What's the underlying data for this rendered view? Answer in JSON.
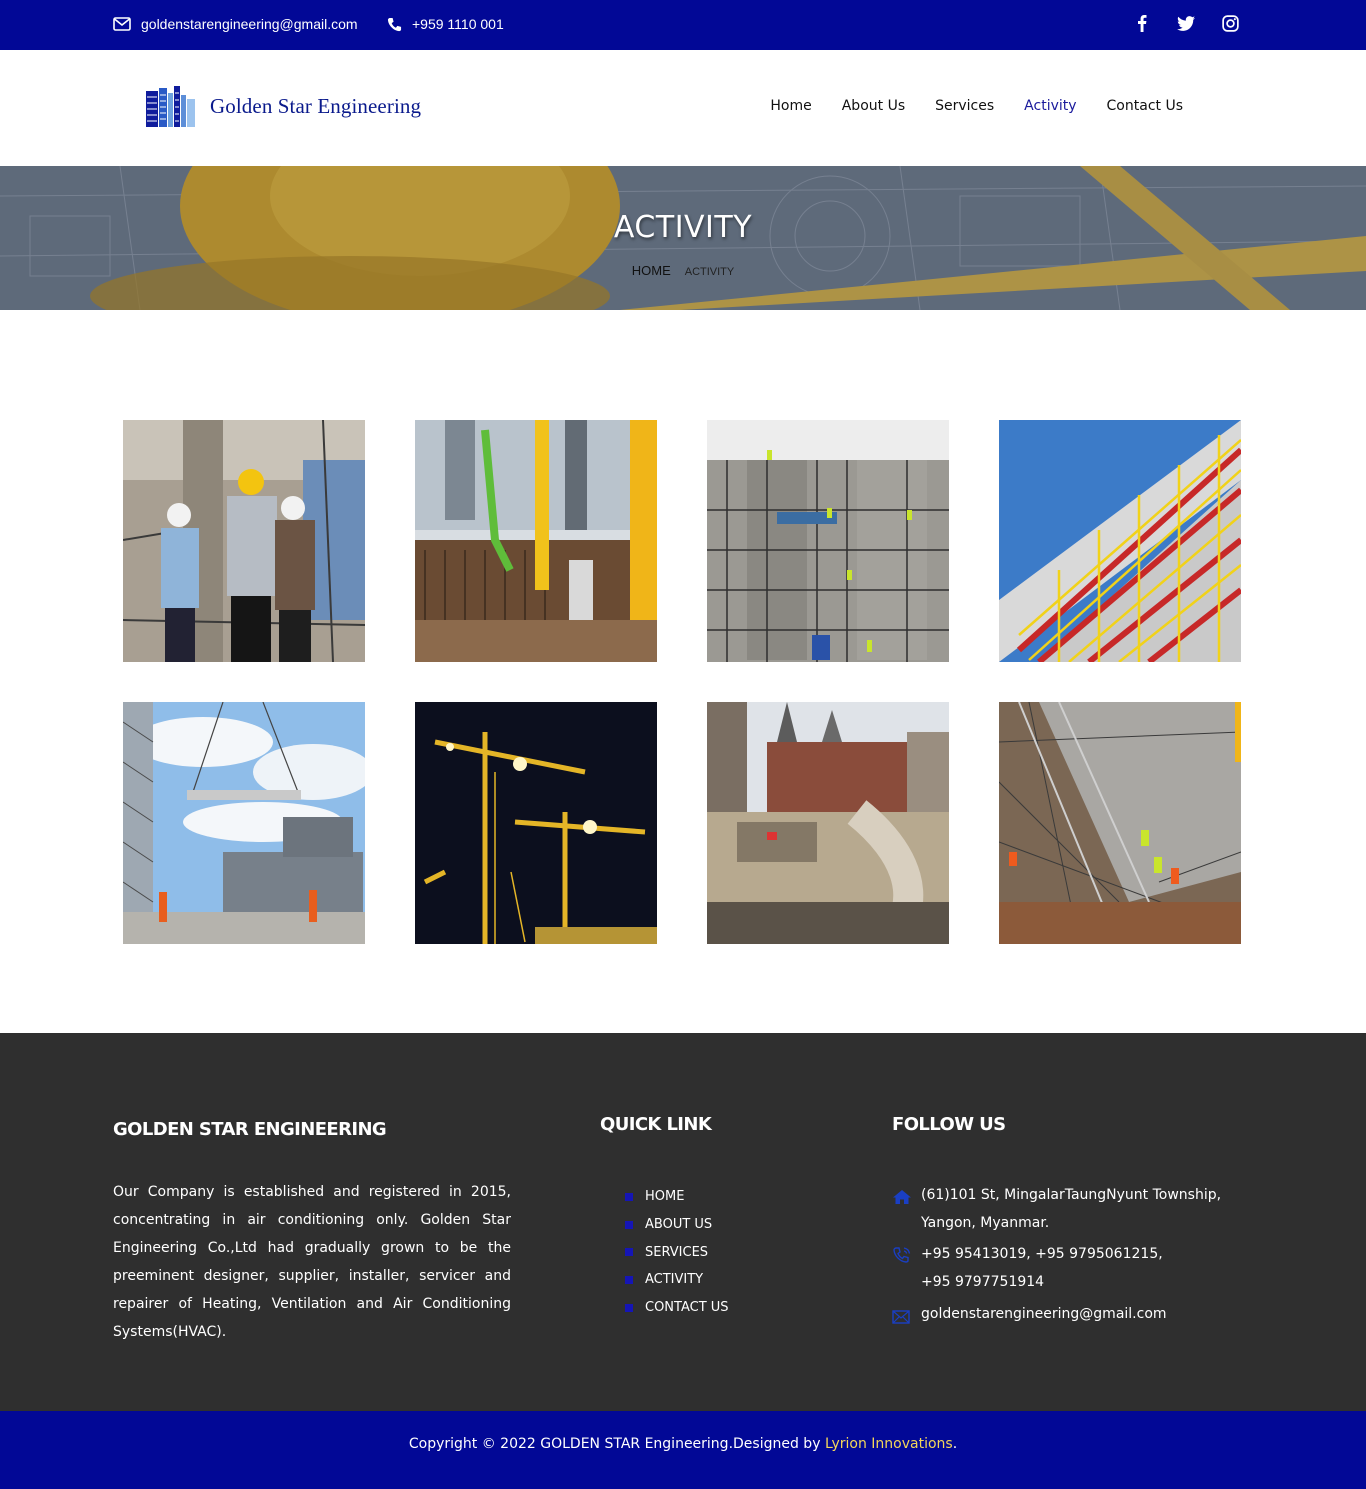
{
  "topbar": {
    "email": "goldenstarengineering@gmail.com",
    "phone": "+959 1110 001",
    "social": [
      "facebook-icon",
      "twitter-icon",
      "instagram-icon"
    ]
  },
  "brand": {
    "name": "Golden Star Engineering"
  },
  "nav": {
    "items": [
      "Home",
      "About Us",
      "Services",
      "Activity",
      "Contact Us"
    ],
    "active": "Activity"
  },
  "banner": {
    "title": "ACTIVITY",
    "breadcrumb": {
      "home": "HOME",
      "current": "ACTIVITY"
    }
  },
  "gallery": {
    "photos": [
      "engineers-inspecting-building",
      "construction-site-crane",
      "building-scaffolding-workers",
      "scaffolding-facade",
      "crane-lifting-slab",
      "tower-cranes-night",
      "excavation-site",
      "concrete-slab-workers"
    ]
  },
  "footer": {
    "company": {
      "title": "GOLDEN STAR ENGINEERING",
      "text": "Our Company is established and registered in 2015, concentrating in air conditioning only. Golden Star Engineering Co.,Ltd had gradually grown to be the preeminent designer, supplier, installer, servicer and repairer of Heating, Ventilation and Air Conditioning Systems(HVAC)."
    },
    "quick": {
      "title": "QUICK LINK",
      "links": [
        "HOME",
        "ABOUT US",
        "SERVICES",
        "ACTIVITY",
        "CONTACT US"
      ]
    },
    "follow": {
      "title": "FOLLOW US",
      "address_1": "(61)101 St, MingalarTaungNyunt Township,",
      "address_2": "Yangon, Myanmar.",
      "phones_1": "+95 95413019, +95 9795061215,",
      "phones_2": "+95 9797751914",
      "email": "goldenstarengineering@gmail.com"
    }
  },
  "copyright": {
    "text": "Copyright © 2022 GOLDEN STAR Engineering.Designed by ",
    "brand": "Lyrion Innovations",
    "end": "."
  },
  "colors": {
    "primary": "#020896",
    "footer": "#2f2f2f",
    "accent": "#f3d65a",
    "nav_active": "#1a1a9c"
  }
}
